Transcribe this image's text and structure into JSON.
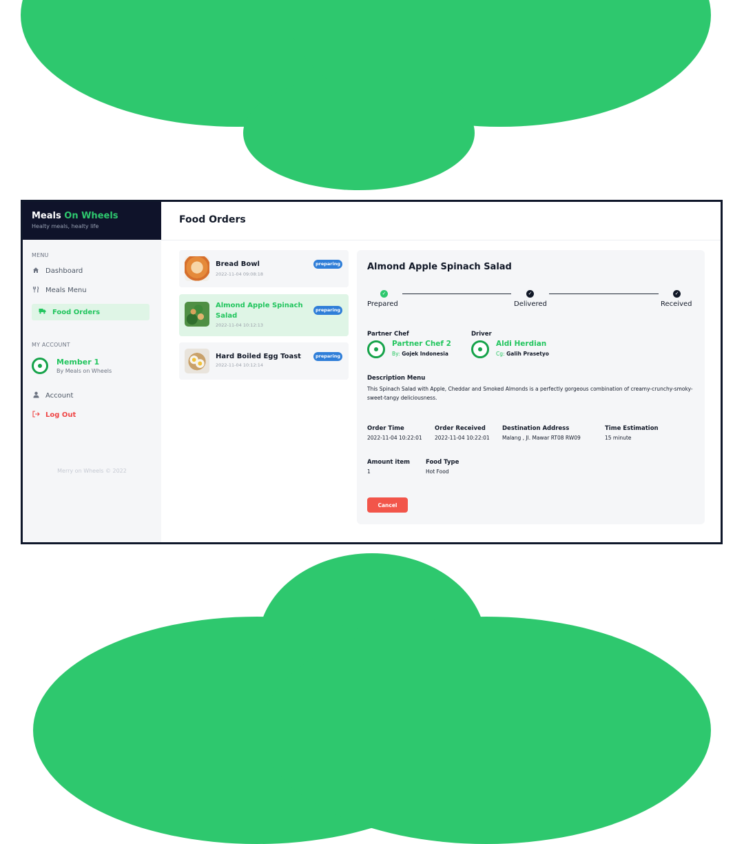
{
  "app": {
    "brand_primary": "Meals",
    "brand_accent": "On Wheels",
    "tagline": "Healty meals, healty life"
  },
  "colors": {
    "accent": "#2ec86e",
    "sidebar_dark": "#0f132a",
    "badge": "#2f7ed8",
    "danger": "#f2554a"
  },
  "sidebar": {
    "menu_label": "MENU",
    "items": [
      {
        "label": "Dashboard",
        "icon": "home-icon"
      },
      {
        "label": "Meals Menu",
        "icon": "fork-knife-icon"
      },
      {
        "label": "Food Orders",
        "icon": "delivery-truck-icon",
        "active": true
      }
    ],
    "account_label": "MY ACCOUNT",
    "member_name": "Member 1",
    "member_sub": "By Meals on Wheels",
    "account_link": "Account",
    "logout": "Log Out",
    "footer": "Merry on Wheels © 2022"
  },
  "header": {
    "title": "Food Orders"
  },
  "orders": [
    {
      "title": "Bread Bowl",
      "time": "2022-11-04 09:08:18",
      "status": "preparing"
    },
    {
      "title": "Almond Apple Spinach",
      "title2": "Salad",
      "time": "2022-11-04 10:12:13",
      "status": "preparing",
      "active": true
    },
    {
      "title": "Hard Boiled Egg Toast",
      "time": "2022-11-04 10:12:14",
      "status": "preparing"
    }
  ],
  "detail": {
    "title": "Almond Apple Spinach Salad",
    "steps": [
      {
        "label": "Prepared",
        "state": "done"
      },
      {
        "label": "Delivered",
        "state": "completed"
      },
      {
        "label": "Received",
        "state": "completed"
      }
    ],
    "chef": {
      "label": "Partner Chef",
      "name": "Partner Chef 2",
      "by_label": "By:",
      "by_value": "Gojek Indonesia"
    },
    "driver": {
      "label": "Driver",
      "name": "Aldi Herdian",
      "by_label": "Cg:",
      "by_value": "Galih Prasetyo"
    },
    "description_label": "Description Menu",
    "description": "This Spinach Salad with Apple, Cheddar and Smoked Almonds is a perfectly gorgeous combination of creamy-crunchy-smoky-sweet-tangy deliciousness.",
    "order_time_label": "Order Time",
    "order_time": "2022-11-04 10:22:01",
    "order_received_label": "Order Received",
    "order_received": "2022-11-04 10:22:01",
    "destination_label": "Destination Address",
    "destination": "Malang , Jl. Mawar RT08 RW09",
    "time_estimation_label": "Time Estimation",
    "time_estimation": "15 minute",
    "amount_label": "Amount item",
    "amount": "1",
    "food_type_label": "Food Type",
    "food_type": "Hot Food",
    "cancel_label": "Cancel"
  }
}
